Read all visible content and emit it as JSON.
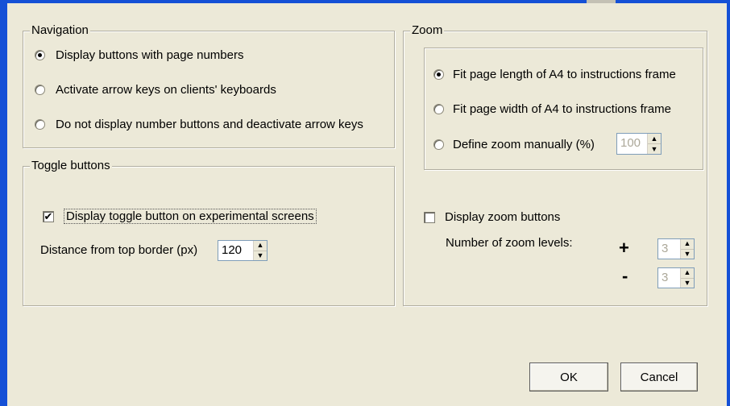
{
  "navigation": {
    "title": "Navigation",
    "options": [
      {
        "label": "Display buttons with page numbers",
        "selected": true
      },
      {
        "label": "Activate arrow keys on clients' keyboards",
        "selected": false
      },
      {
        "label": "Do not display number buttons and deactivate arrow keys",
        "selected": false
      }
    ]
  },
  "toggle": {
    "title": "Toggle buttons",
    "checkbox_label": "Display toggle button on experimental screens",
    "checked": true,
    "distance_label": "Distance from top border (px)",
    "distance_value": "120"
  },
  "zoom": {
    "title": "Zoom",
    "options": [
      {
        "label": "Fit page length of A4 to instructions frame",
        "selected": true
      },
      {
        "label": "Fit page width of A4 to instructions frame",
        "selected": false
      },
      {
        "label": "Define zoom manually (%)",
        "selected": false
      }
    ],
    "manual_value": "100",
    "zoom_buttons_label": "Display zoom buttons",
    "zoom_buttons_checked": false,
    "levels_label": "Number of zoom levels:",
    "plus_symbol": "+",
    "minus_symbol": "-",
    "plus_value": "3",
    "minus_value": "3"
  },
  "buttons": {
    "ok": "OK",
    "cancel": "Cancel"
  },
  "colors": {
    "window_frame": "#1550d6",
    "dialog_bg": "#ece9d8"
  }
}
